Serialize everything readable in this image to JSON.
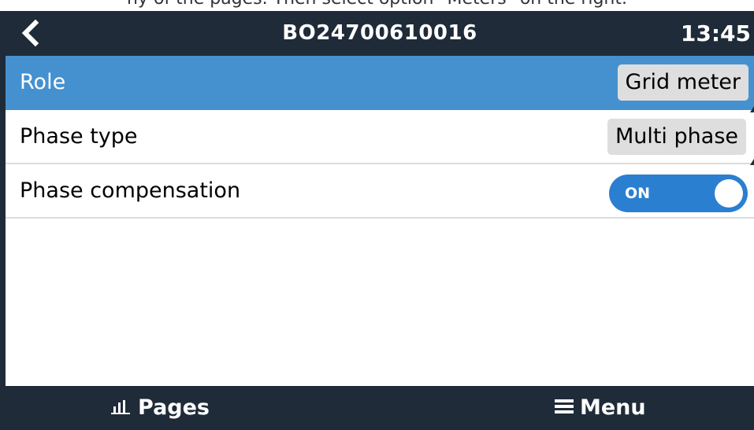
{
  "top_strip_text": "ny of the pages. Then select option \"Meters\" on the right.",
  "header": {
    "back_icon": "chevron-left-icon",
    "title": "BO24700610016",
    "clock": "13:45"
  },
  "rows": [
    {
      "label": "Role",
      "value": "Grid meter",
      "selected": true
    },
    {
      "label": "Phase type",
      "value": "Multi phase",
      "selected": false
    },
    {
      "label": "Phase compensation",
      "toggle_text": "ON",
      "toggle_state": true
    }
  ],
  "footer": {
    "pages_icon": "bar-chart-icon",
    "pages_label": "Pages",
    "menu_icon": "hamburger-menu-icon",
    "menu_label": "Menu"
  },
  "colors": {
    "header_bg": "#1f2b38",
    "selected_row": "#4591d0",
    "toggle_on": "#2a7fd0"
  }
}
